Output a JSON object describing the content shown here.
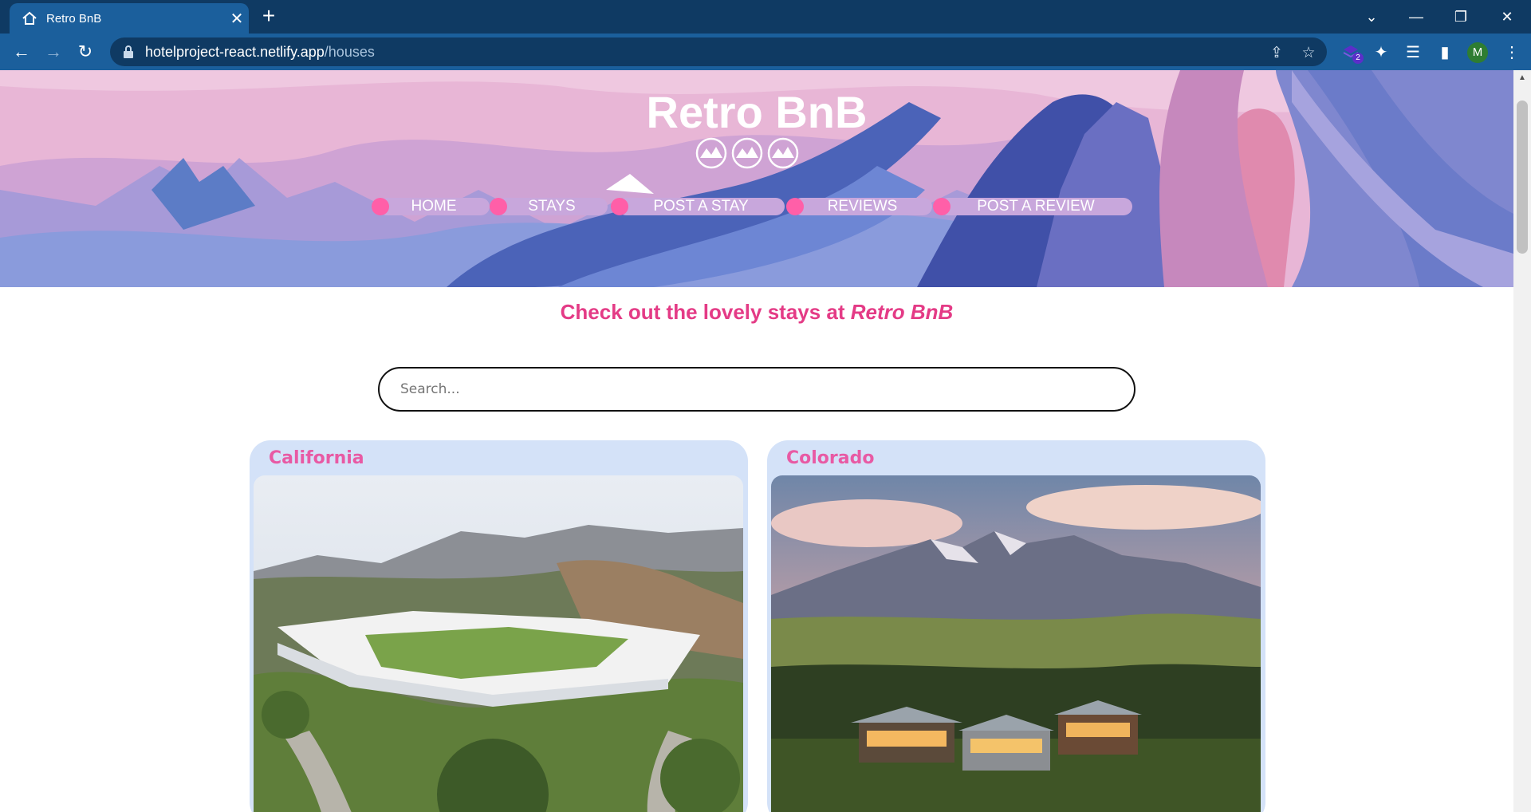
{
  "browser": {
    "tab_title": "Retro BnB",
    "tab_icon": "home-icon",
    "url_host": "hotelproject-react.netlify.app",
    "url_path": "/houses",
    "profile_initial": "M",
    "extension_badge": "2"
  },
  "site": {
    "title": "Retro BnB",
    "nav": [
      "HOME",
      "STAYS",
      "POST A STAY",
      "REVIEWS",
      "POST A REVIEW"
    ],
    "headline_prefix": "Check out the lovely stays at ",
    "headline_brand": "Retro BnB",
    "search_placeholder": "Search..."
  },
  "listings": [
    {
      "name": "California"
    },
    {
      "name": "Colorado"
    }
  ],
  "colors": {
    "chrome_dark": "#0f3a63",
    "chrome_light": "#1b5f9c",
    "accent_pink": "#e43b86",
    "nav_pill": "#c8a7dc",
    "card_bg": "#d4e2f8"
  }
}
